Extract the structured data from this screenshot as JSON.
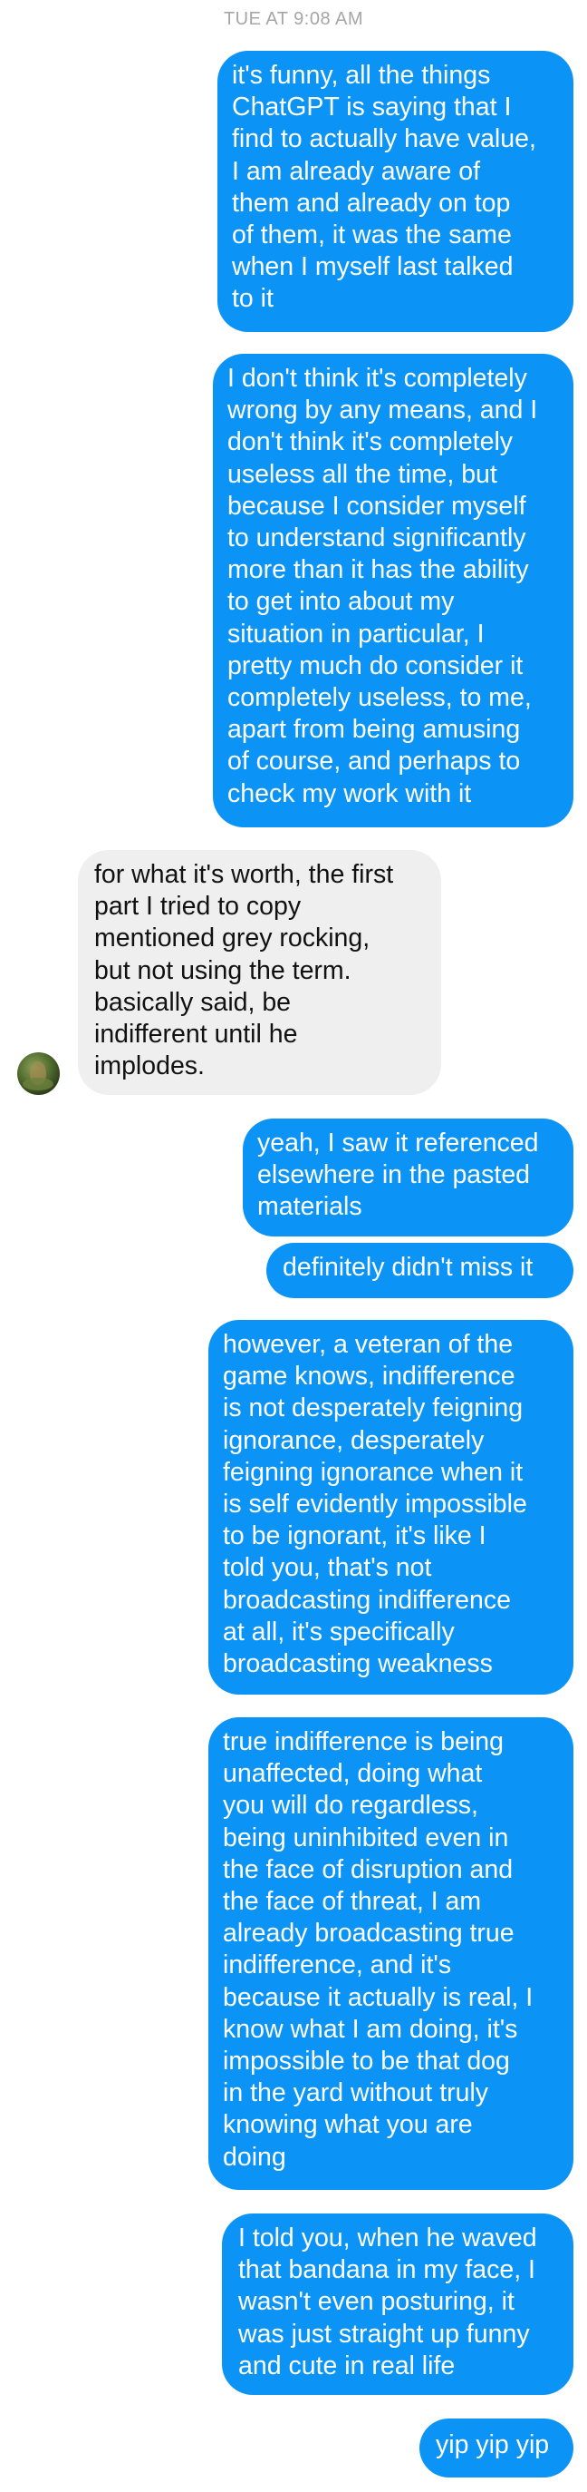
{
  "thread": {
    "timestamp": "TUE AT 9:08 AM",
    "messages": [
      {
        "sender": "me",
        "text": "it's funny, all the things\nChatGPT is saying that I\nfind to actually have value,\nI am already aware of\nthem and already on top\nof them, it was the same\nwhen I myself last talked\nto it"
      },
      {
        "sender": "me",
        "text": "I don't think it's completely\nwrong by any means, and I\ndon't think it's completely\nuseless all the time, but\nbecause I consider myself\nto understand significantly\nmore than it has the ability\nto get into about my\nsituation in particular, I\npretty much do consider it\ncompletely useless, to me,\napart from being amusing\nof course, and perhaps to\ncheck my work with it"
      },
      {
        "sender": "them",
        "text": "for what it's worth, the first\npart I tried to copy\nmentioned grey rocking,\nbut not using the term.\nbasically said, be\nindifferent until he\nimplodes."
      },
      {
        "sender": "me",
        "text": "yeah, I saw it referenced\nelsewhere in the pasted\nmaterials"
      },
      {
        "sender": "me",
        "text": "definitely didn't miss it"
      },
      {
        "sender": "me",
        "text": "however, a veteran of the\ngame knows, indifference\nis not desperately feigning\nignorance, desperately\nfeigning ignorance when it\nis self evidently impossible\nto be ignorant, it's like I\ntold you, that's not\nbroadcasting indifference\nat all, it's specifically\nbroadcasting weakness"
      },
      {
        "sender": "me",
        "text": "true indifference is being\nunaffected, doing what\nyou will do regardless,\nbeing uninhibited even in\nthe face of disruption and\nthe face of threat, I am\nalready broadcasting true\nindifference, and it's\nbecause it actually is real, I\nknow what I am doing, it's\nimpossible to be that dog\nin the yard without truly\nknowing what you are\ndoing"
      },
      {
        "sender": "me",
        "text": "I told you, when he waved\nthat bandana in my face, I\nwasn't even posturing, it\nwas just straight up funny\nand cute in real life"
      },
      {
        "sender": "me",
        "text": "yip yip yip"
      }
    ]
  },
  "colors": {
    "outgoing_bubble": "#0b93f6",
    "incoming_bubble": "#efefef",
    "timestamp": "#a6a6a6"
  }
}
